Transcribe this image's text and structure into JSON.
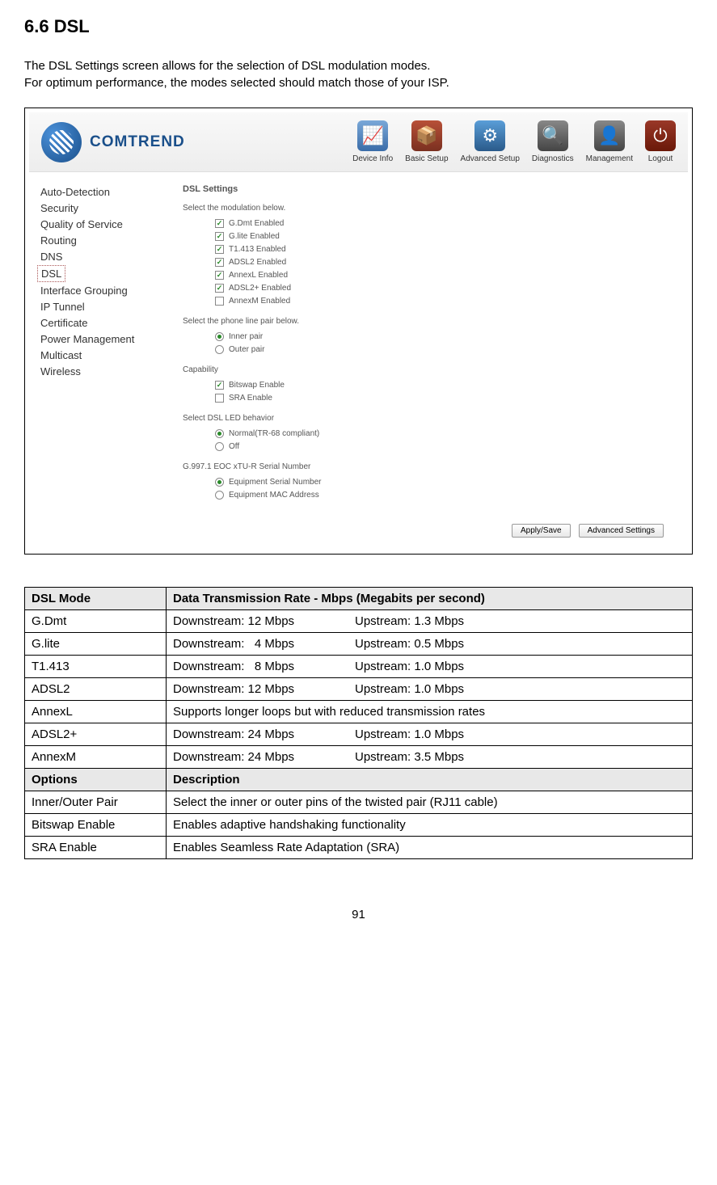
{
  "section": {
    "number": "6.6",
    "title": "DSL"
  },
  "intro": {
    "line1": "The DSL Settings screen allows for the selection of DSL modulation modes.",
    "line2": "For optimum performance, the modes selected should match those of your ISP."
  },
  "logo_text": "COMTREND",
  "nav": [
    {
      "label": "Device Info",
      "glyph": "📈"
    },
    {
      "label": "Basic Setup",
      "glyph": "📦"
    },
    {
      "label": "Advanced Setup",
      "glyph": "⚙"
    },
    {
      "label": "Diagnostics",
      "glyph": "🔍"
    },
    {
      "label": "Management",
      "glyph": "👤"
    },
    {
      "label": "Logout",
      "glyph": "⏻"
    }
  ],
  "sidebar": [
    "Auto-Detection",
    "Security",
    "Quality of Service",
    "Routing",
    "DNS",
    "DSL",
    "Interface Grouping",
    "IP Tunnel",
    "Certificate",
    "Power Management",
    "Multicast",
    "Wireless"
  ],
  "sidebar_selected": "DSL",
  "panel": {
    "title": "DSL Settings",
    "mod_label": "Select the modulation below.",
    "modulations": [
      {
        "label": "G.Dmt Enabled",
        "checked": true
      },
      {
        "label": "G.lite Enabled",
        "checked": true
      },
      {
        "label": "T1.413 Enabled",
        "checked": true
      },
      {
        "label": "ADSL2 Enabled",
        "checked": true
      },
      {
        "label": "AnnexL Enabled",
        "checked": true
      },
      {
        "label": "ADSL2+ Enabled",
        "checked": true
      },
      {
        "label": "AnnexM Enabled",
        "checked": false
      }
    ],
    "pair_label": "Select the phone line pair below.",
    "pairs": [
      {
        "label": "Inner pair",
        "checked": true
      },
      {
        "label": "Outer pair",
        "checked": false
      }
    ],
    "capability_label": "Capability",
    "capability": [
      {
        "label": "Bitswap Enable",
        "checked": true
      },
      {
        "label": "SRA Enable",
        "checked": false
      }
    ],
    "led_label": "Select DSL LED behavior",
    "led_options": [
      {
        "label": "Normal(TR-68 compliant)",
        "checked": true
      },
      {
        "label": "Off",
        "checked": false
      }
    ],
    "serial_label": "G.997.1 EOC xTU-R Serial Number",
    "serial_options": [
      {
        "label": "Equipment Serial Number",
        "checked": true
      },
      {
        "label": "Equipment MAC Address",
        "checked": false
      }
    ],
    "btn_apply": "Apply/Save",
    "btn_adv": "Advanced Settings"
  },
  "table": {
    "hdr_mode": "DSL Mode",
    "hdr_rate": "Data Transmission Rate - Mbps (Megabits per second)",
    "rows": [
      {
        "mode": "G.Dmt",
        "down": "Downstream: 12 Mbps",
        "up": "Upstream: 1.3 Mbps"
      },
      {
        "mode": "G.lite",
        "down": "Downstream:   4 Mbps",
        "up": "Upstream: 0.5 Mbps"
      },
      {
        "mode": "T1.413",
        "down": "Downstream:   8 Mbps",
        "up": "Upstream: 1.0 Mbps"
      },
      {
        "mode": "ADSL2",
        "down": "Downstream: 12 Mbps",
        "up": "Upstream: 1.0 Mbps"
      },
      {
        "mode": "AnnexL",
        "full": "Supports longer loops but with reduced transmission rates"
      },
      {
        "mode": "ADSL2+",
        "down": "Downstream: 24 Mbps",
        "up": "Upstream: 1.0 Mbps"
      },
      {
        "mode": "AnnexM",
        "down": "Downstream: 24 Mbps",
        "up": "Upstream: 3.5 Mbps"
      }
    ],
    "hdr_options": "Options",
    "hdr_desc": "Description",
    "options": [
      {
        "opt": "Inner/Outer Pair",
        "desc": "Select the inner or outer pins of the twisted pair (RJ11 cable)"
      },
      {
        "opt": "Bitswap Enable",
        "desc": "Enables adaptive handshaking functionality"
      },
      {
        "opt": "SRA Enable",
        "desc": "Enables Seamless Rate Adaptation (SRA)"
      }
    ]
  },
  "page_number": "91"
}
